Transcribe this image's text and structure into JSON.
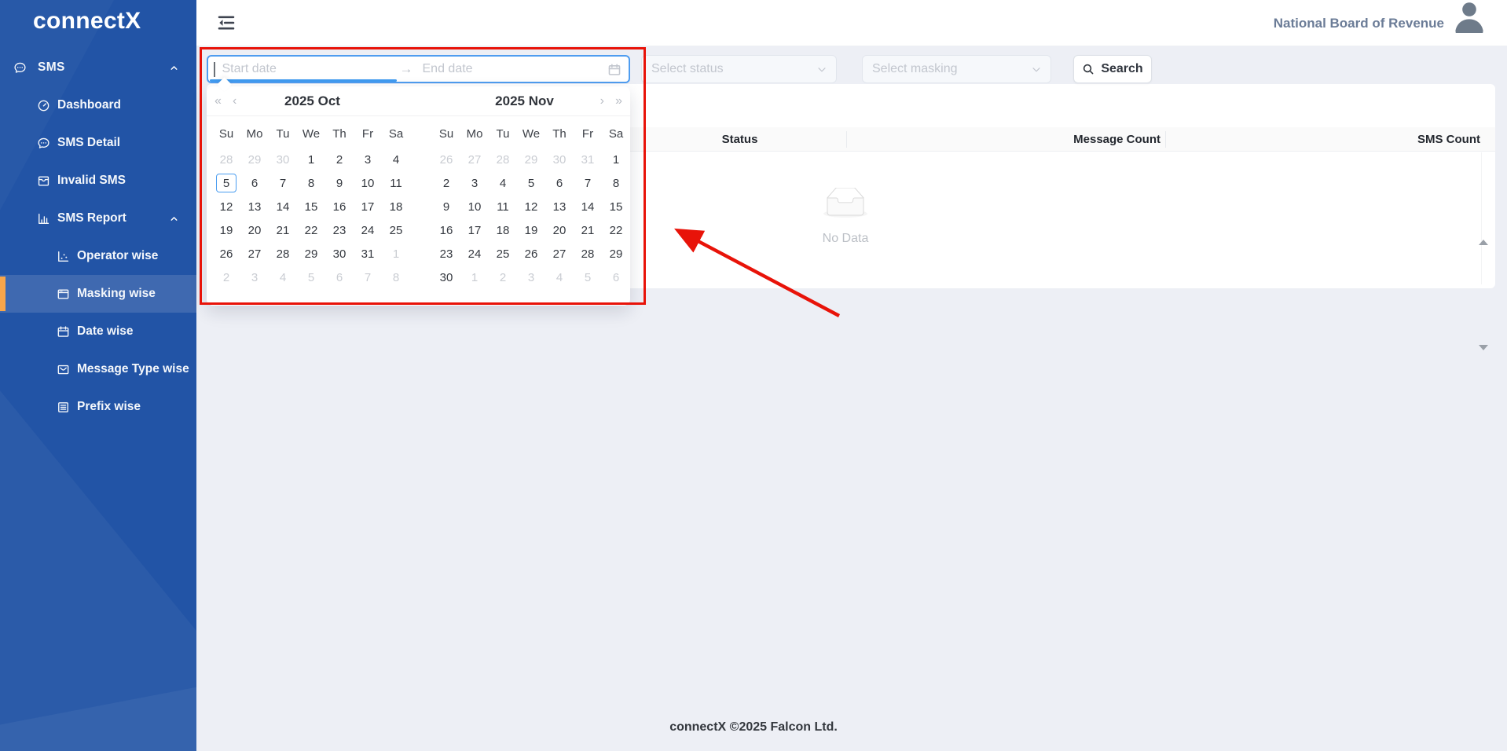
{
  "app": {
    "name": "connectX",
    "footer": "connectX ©2025 Falcon Ltd."
  },
  "topbar": {
    "organization": "National Board of Revenue"
  },
  "sidebar": {
    "section": {
      "label": "SMS"
    },
    "items": [
      {
        "label": "Dashboard",
        "icon": "dashboard-icon"
      },
      {
        "label": "SMS Detail",
        "icon": "chat-icon"
      },
      {
        "label": "Invalid SMS",
        "icon": "inbox-icon"
      },
      {
        "label": "SMS Report",
        "icon": "bar-chart-icon"
      }
    ],
    "report_items": [
      {
        "label": "Operator wise",
        "icon": "scatter-chart-icon",
        "active": false
      },
      {
        "label": "Masking wise",
        "icon": "window-icon",
        "active": true
      },
      {
        "label": "Date wise",
        "icon": "calendar-icon",
        "active": false
      },
      {
        "label": "Message Type wise",
        "icon": "mail-icon",
        "active": false
      },
      {
        "label": "Prefix wise",
        "icon": "list-icon",
        "active": false
      }
    ]
  },
  "filters": {
    "start_date_placeholder": "Start date",
    "end_date_placeholder": "End date",
    "status_placeholder": "Select status",
    "masking_placeholder": "Select masking",
    "search_label": "Search"
  },
  "icons": {
    "super_prev": "«",
    "prev": "‹",
    "next": "›",
    "super_next": "»",
    "range_separator": "→"
  },
  "calendar": {
    "day_names": [
      "Su",
      "Mo",
      "Tu",
      "We",
      "Th",
      "Fr",
      "Sa"
    ],
    "months": [
      {
        "year": "2025",
        "month": "Oct",
        "weeks": [
          [
            {
              "d": 28,
              "muted": true
            },
            {
              "d": 29,
              "muted": true
            },
            {
              "d": 30,
              "muted": true
            },
            {
              "d": 1
            },
            {
              "d": 2
            },
            {
              "d": 3
            },
            {
              "d": 4
            }
          ],
          [
            {
              "d": 5,
              "today": true
            },
            {
              "d": 6
            },
            {
              "d": 7
            },
            {
              "d": 8
            },
            {
              "d": 9
            },
            {
              "d": 10
            },
            {
              "d": 11
            }
          ],
          [
            {
              "d": 12
            },
            {
              "d": 13
            },
            {
              "d": 14
            },
            {
              "d": 15
            },
            {
              "d": 16
            },
            {
              "d": 17
            },
            {
              "d": 18
            }
          ],
          [
            {
              "d": 19
            },
            {
              "d": 20
            },
            {
              "d": 21
            },
            {
              "d": 22
            },
            {
              "d": 23
            },
            {
              "d": 24
            },
            {
              "d": 25
            }
          ],
          [
            {
              "d": 26
            },
            {
              "d": 27
            },
            {
              "d": 28
            },
            {
              "d": 29
            },
            {
              "d": 30
            },
            {
              "d": 31
            },
            {
              "d": 1,
              "muted": true
            }
          ],
          [
            {
              "d": 2,
              "muted": true
            },
            {
              "d": 3,
              "muted": true
            },
            {
              "d": 4,
              "muted": true
            },
            {
              "d": 5,
              "muted": true
            },
            {
              "d": 6,
              "muted": true
            },
            {
              "d": 7,
              "muted": true
            },
            {
              "d": 8,
              "muted": true
            }
          ]
        ]
      },
      {
        "year": "2025",
        "month": "Nov",
        "weeks": [
          [
            {
              "d": 26,
              "muted": true
            },
            {
              "d": 27,
              "muted": true
            },
            {
              "d": 28,
              "muted": true
            },
            {
              "d": 29,
              "muted": true
            },
            {
              "d": 30,
              "muted": true
            },
            {
              "d": 31,
              "muted": true
            },
            {
              "d": 1
            }
          ],
          [
            {
              "d": 2
            },
            {
              "d": 3
            },
            {
              "d": 4
            },
            {
              "d": 5
            },
            {
              "d": 6
            },
            {
              "d": 7
            },
            {
              "d": 8
            }
          ],
          [
            {
              "d": 9
            },
            {
              "d": 10
            },
            {
              "d": 11
            },
            {
              "d": 12
            },
            {
              "d": 13
            },
            {
              "d": 14
            },
            {
              "d": 15
            }
          ],
          [
            {
              "d": 16
            },
            {
              "d": 17
            },
            {
              "d": 18
            },
            {
              "d": 19
            },
            {
              "d": 20
            },
            {
              "d": 21
            },
            {
              "d": 22
            }
          ],
          [
            {
              "d": 23
            },
            {
              "d": 24
            },
            {
              "d": 25
            },
            {
              "d": 26
            },
            {
              "d": 27
            },
            {
              "d": 28
            },
            {
              "d": 29
            }
          ],
          [
            {
              "d": 30
            },
            {
              "d": 1,
              "muted": true
            },
            {
              "d": 2,
              "muted": true
            },
            {
              "d": 3,
              "muted": true
            },
            {
              "d": 4,
              "muted": true
            },
            {
              "d": 5,
              "muted": true
            },
            {
              "d": 6,
              "muted": true
            }
          ]
        ]
      }
    ]
  },
  "table": {
    "columns": [
      "Status",
      "Message Count",
      "SMS Count"
    ],
    "empty_text": "No Data"
  },
  "annotation": {
    "color": "#e81309"
  },
  "colors": {
    "sidebar_blue": "#2254a6",
    "active_item_blue": "#3f69b0",
    "accent_orange": "#f9a64a",
    "focus_blue": "#4a9df0"
  }
}
